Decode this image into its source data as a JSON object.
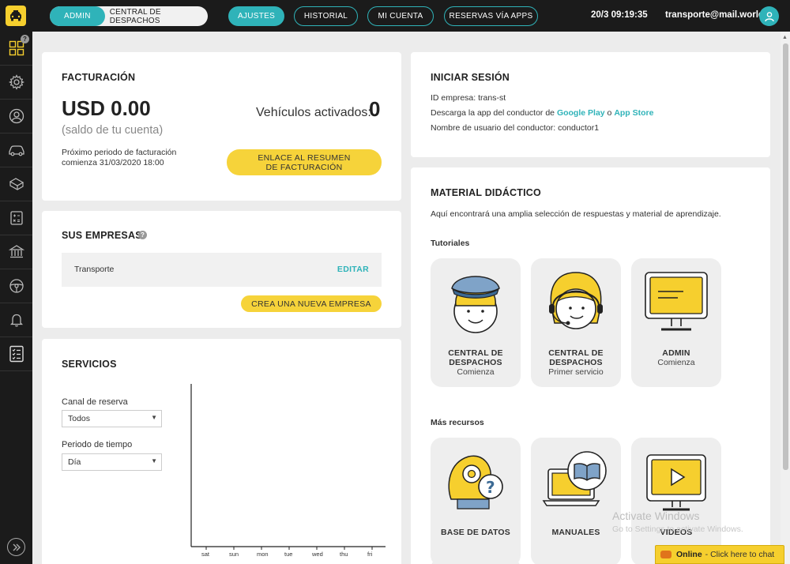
{
  "topbar": {
    "toggle_on": "ADMIN",
    "toggle_off": "CENTRAL DE DESPACHOS",
    "nav": [
      "AJUSTES",
      "HISTORIAL",
      "MI CUENTA",
      "RESERVAS VÍA APPS"
    ],
    "clock": "20/3 09:19:35",
    "email": "transporte@mail.world"
  },
  "sidebar": {
    "badge": "?"
  },
  "billing": {
    "title": "FACTURACIÓN",
    "balance": "USD 0.00",
    "balance_sub": "(saldo de tu cuenta)",
    "vehicles_label": "Vehículos activados:",
    "vehicles_count": "0",
    "period_line1": "Próximo periodo de facturación",
    "period_line2": "comienza 31/03/2020 18:00",
    "summary_button": "ENLACE AL RESUMEN DE FACTURACIÓN"
  },
  "companies": {
    "title": "SUS EMPRESAS",
    "help": "?",
    "items": [
      {
        "name": "Transporte",
        "action": "EDITAR"
      }
    ],
    "new_button": "CREA UNA NUEVA EMPRESA"
  },
  "services": {
    "title": "SERVICIOS",
    "channel_label": "Canal de reserva",
    "channel_value": "Todos",
    "period_label": "Periodo de tiempo",
    "period_value": "Día",
    "caret": "▼"
  },
  "chart_data": {
    "type": "bar",
    "categories": [
      "sat",
      "sun",
      "mon",
      "tue",
      "wed",
      "thu",
      "fri"
    ],
    "values": [],
    "title": "",
    "xlabel": "",
    "ylabel": ""
  },
  "login": {
    "title": "INICIAR SESIÓN",
    "company_id": "ID empresa: trans-st",
    "download_prefix": "Descarga la app del conductor de ",
    "google_play": "Google Play",
    "or": " o ",
    "app_store": "App Store",
    "driver_user": "Nombre de usuario del conductor: conductor1"
  },
  "material": {
    "title": "MATERIAL DIDÁCTICO",
    "intro": "Aquí encontrará una amplia selección de respuestas y material de aprendizaje.",
    "tutorials_label": "Tutoriales",
    "tutorials": [
      {
        "title1": "CENTRAL DE",
        "title2": "DESPACHOS",
        "sub": "Comienza"
      },
      {
        "title1": "CENTRAL DE",
        "title2": "DESPACHOS",
        "sub": "Primer servicio"
      },
      {
        "title1": "ADMIN",
        "title2": "",
        "sub": "Comienza"
      }
    ],
    "resources_label": "Más recursos",
    "resources": [
      "BASE DE DATOS",
      "MANUALES",
      "VIDEOS"
    ]
  },
  "overlay": {
    "watermark_title": "Activate Windows",
    "watermark_sub": "Go to Settings to activate Windows.",
    "chat_status": "Online",
    "chat_text": "- Click here to chat"
  },
  "colors": {
    "accent": "#2fb3b9",
    "yellow": "#f6d33a",
    "dark": "#1b1b1b"
  }
}
